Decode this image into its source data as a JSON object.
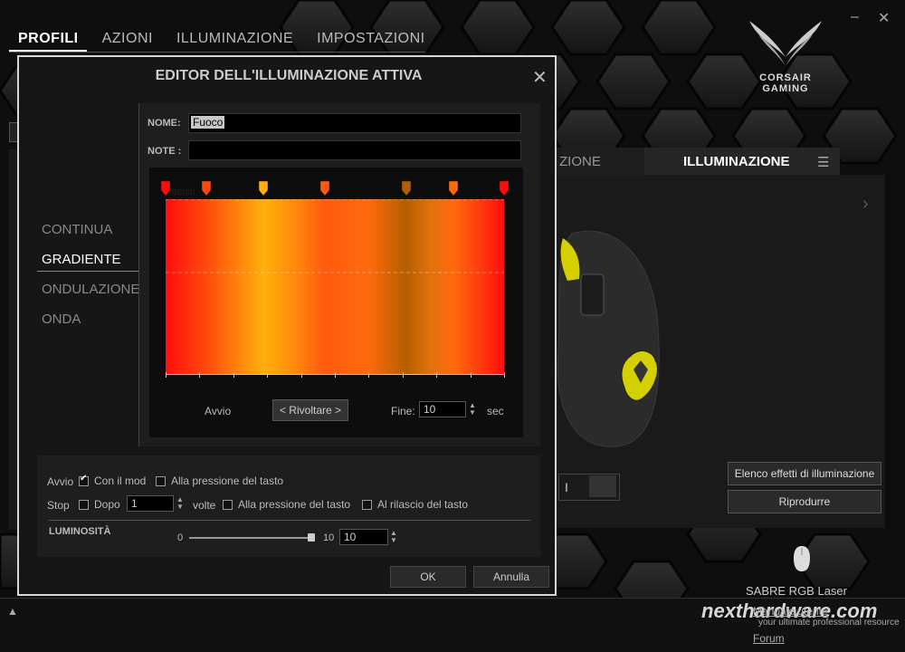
{
  "nav": {
    "tabs": [
      "PROFILI",
      "AZIONI",
      "ILLUMINAZIONE",
      "IMPOSTAZIONI"
    ],
    "active_tab": "PROFILI"
  },
  "window": {
    "minimize": "–",
    "close": "✕"
  },
  "logo": {
    "line1": "CORSAIR",
    "line2": "GAMING"
  },
  "right_panel": {
    "tab_left": "ZIONE",
    "tab_active": "ILLUMINAZIONE",
    "menu_icon": "menu-icon",
    "switch_label": "I",
    "buttons": [
      "Elenco effetti di illuminazione",
      "Riprodurre"
    ],
    "device_name": "SABRE RGB Laser",
    "links": [
      "Manuale utente",
      "Forum"
    ]
  },
  "watermark": {
    "title": "nexthardware.com",
    "subtitle": "your ultimate professional resource"
  },
  "dialog": {
    "title": "EDITOR DELL'ILLUMINAZIONE ATTIVA",
    "close": "✕",
    "side_menu": [
      "CONTINUA",
      "GRADIENTE",
      "ONDULAZIONE",
      "ONDA"
    ],
    "active_item": "GRADIENTE",
    "nome_label": "NOME:",
    "nome_value": "Fuoco",
    "note_label": "NOTE :",
    "note_value": "",
    "intensity_label": "Intensi",
    "gradient_stops": [
      {
        "pos": 0.0,
        "color": "#ff0d0d"
      },
      {
        "pos": 0.12,
        "color": "#ff4a0d"
      },
      {
        "pos": 0.29,
        "color": "#ffb00d"
      },
      {
        "pos": 0.47,
        "color": "#ff5a0d"
      },
      {
        "pos": 0.71,
        "color": "#b35f00"
      },
      {
        "pos": 0.85,
        "color": "#ff6a0d"
      },
      {
        "pos": 1.0,
        "color": "#ff0d0d"
      }
    ],
    "avvio_label": "Avvio",
    "reverse_button": "< Rivoltare >",
    "fine_label": "Fine:",
    "fine_value": "10",
    "sec_label": "sec",
    "options": {
      "avvio_label": "Avvio",
      "con_il_mod": "Con il mod",
      "con_il_mod_checked": true,
      "alla_pressione": "Alla pressione del tasto",
      "stop_label": "Stop",
      "dopo_label": "Dopo",
      "dopo_value": "1",
      "volte_label": "volte",
      "stop_pressione": "Alla pressione del tasto",
      "al_rilascio": "Al rilascio del tasto"
    },
    "luminosita": {
      "label": "LUMINOSITÀ",
      "min": "0",
      "max": "10",
      "value": "10"
    },
    "ok_button": "OK",
    "cancel_button": "Annulla"
  }
}
